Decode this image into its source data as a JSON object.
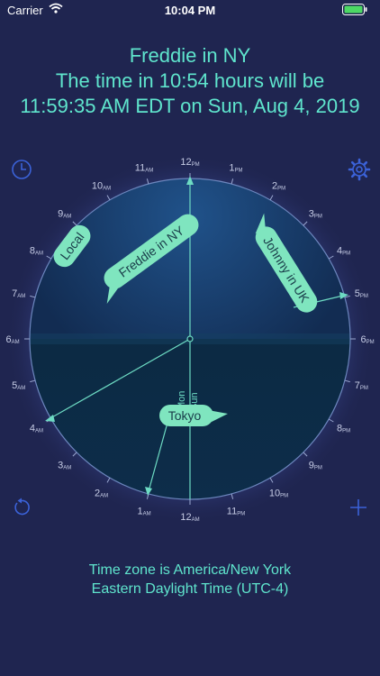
{
  "status_bar": {
    "carrier": "Carrier",
    "time": "10:04 PM"
  },
  "header": {
    "line1": "Freddie in NY",
    "line2": "The time in 10:54 hours will be",
    "line3": "11:59:35 AM EDT on Sun, Aug 4, 2019"
  },
  "dial": {
    "hour_labels": [
      {
        "n": "12",
        "s": "PM",
        "a": 0
      },
      {
        "n": "1",
        "s": "PM",
        "a": 15
      },
      {
        "n": "2",
        "s": "PM",
        "a": 30
      },
      {
        "n": "3",
        "s": "PM",
        "a": 45
      },
      {
        "n": "4",
        "s": "PM",
        "a": 60
      },
      {
        "n": "5",
        "s": "PM",
        "a": 75
      },
      {
        "n": "6",
        "s": "PM",
        "a": 90
      },
      {
        "n": "7",
        "s": "PM",
        "a": 105
      },
      {
        "n": "8",
        "s": "PM",
        "a": 120
      },
      {
        "n": "9",
        "s": "PM",
        "a": 135
      },
      {
        "n": "10",
        "s": "PM",
        "a": 150
      },
      {
        "n": "11",
        "s": "PM",
        "a": 165
      },
      {
        "n": "12",
        "s": "AM",
        "a": 180
      },
      {
        "n": "1",
        "s": "AM",
        "a": 195
      },
      {
        "n": "2",
        "s": "AM",
        "a": 210
      },
      {
        "n": "3",
        "s": "AM",
        "a": 225
      },
      {
        "n": "4",
        "s": "AM",
        "a": 240
      },
      {
        "n": "5",
        "s": "AM",
        "a": 255
      },
      {
        "n": "6",
        "s": "AM",
        "a": 270
      },
      {
        "n": "7",
        "s": "AM",
        "a": 285
      },
      {
        "n": "8",
        "s": "AM",
        "a": 300
      },
      {
        "n": "9",
        "s": "AM",
        "a": 315
      },
      {
        "n": "10",
        "s": "AM",
        "a": 330
      },
      {
        "n": "11",
        "s": "AM",
        "a": 345
      }
    ],
    "day_labels": [
      "Mon",
      "Sun"
    ],
    "bubbles": {
      "local": "Local",
      "freddie": "Freddie in NY",
      "johnny": "Johnny in UK",
      "tokyo": "Tokyo"
    }
  },
  "footer": {
    "line1": "Time zone is America/New York",
    "line2": "Eastern Daylight Time (UTC-4)"
  },
  "icons": {
    "top_left": "clock-icon",
    "top_right": "gear-icon",
    "bottom_left": "reset-icon",
    "bottom_right": "plus-icon"
  },
  "colors": {
    "accent": "#5fe5cd",
    "background": "#1f2550",
    "icon": "#3b62d8"
  }
}
